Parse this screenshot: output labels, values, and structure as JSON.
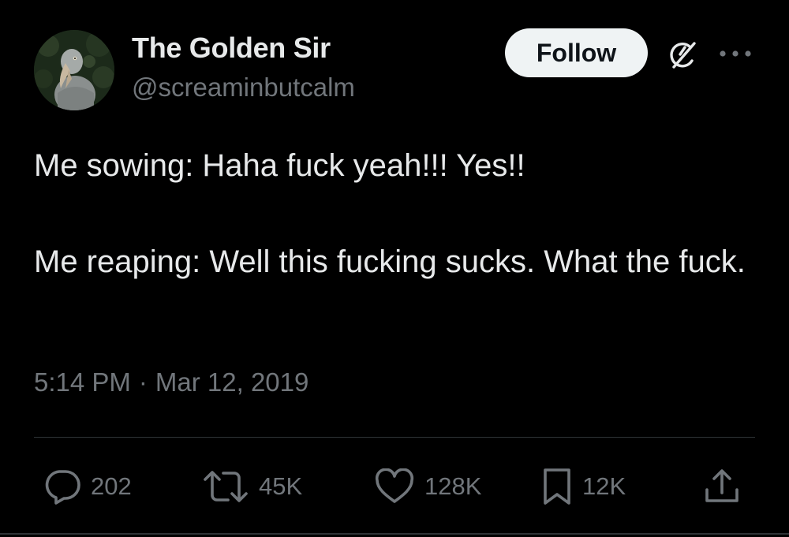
{
  "author": {
    "display_name": "The Golden Sir",
    "handle": "@screaminbutcalm",
    "avatar_icon": "shoebill-bird-avatar"
  },
  "header": {
    "follow_label": "Follow",
    "grok_icon": "grok-icon",
    "more_icon": "more-horizontal-icon"
  },
  "tweet": {
    "paragraphs": [
      "Me sowing: Haha fuck yeah!!! Yes!!",
      "Me reaping: Well this fucking sucks. What the fuck."
    ],
    "time": "5:14 PM",
    "separator": "·",
    "date": "Mar 12, 2019"
  },
  "actions": {
    "reply": {
      "icon": "reply-icon",
      "count": "202"
    },
    "retweet": {
      "icon": "retweet-icon",
      "count": "45K"
    },
    "like": {
      "icon": "heart-icon",
      "count": "128K"
    },
    "bookmark": {
      "icon": "bookmark-icon",
      "count": "12K"
    },
    "share": {
      "icon": "share-icon"
    }
  },
  "colors": {
    "background": "#000000",
    "primary_text": "#e7e9ea",
    "secondary_text": "#71767b",
    "divider": "#2f3336",
    "follow_button_bg": "#eff3f4"
  }
}
